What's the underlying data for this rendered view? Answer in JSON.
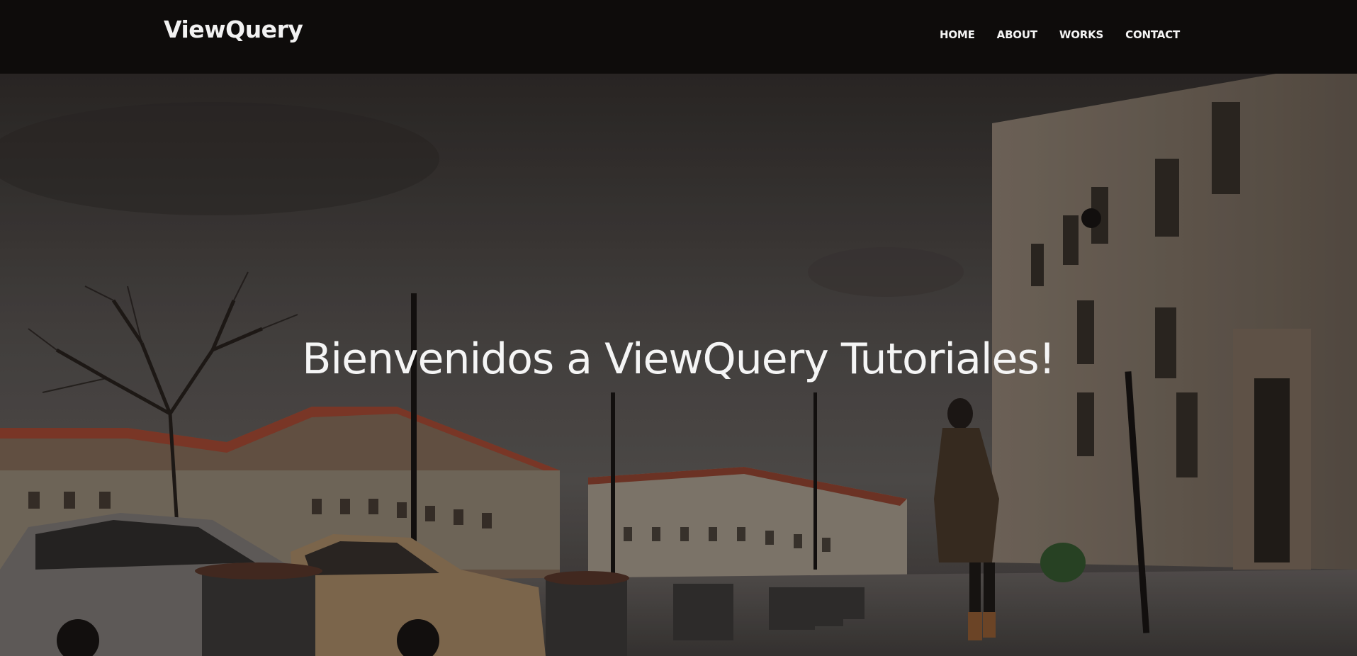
{
  "brand": {
    "name": "ViewQuery"
  },
  "nav": {
    "items": [
      {
        "label": "HOME"
      },
      {
        "label": "ABOUT"
      },
      {
        "label": "WORKS"
      },
      {
        "label": "CONTACT"
      }
    ]
  },
  "hero": {
    "title": "Bienvenidos a ViewQuery Tutoriales!"
  },
  "colors": {
    "navbar_bg": "#0e0c0b",
    "text": "#f5f5f5"
  }
}
